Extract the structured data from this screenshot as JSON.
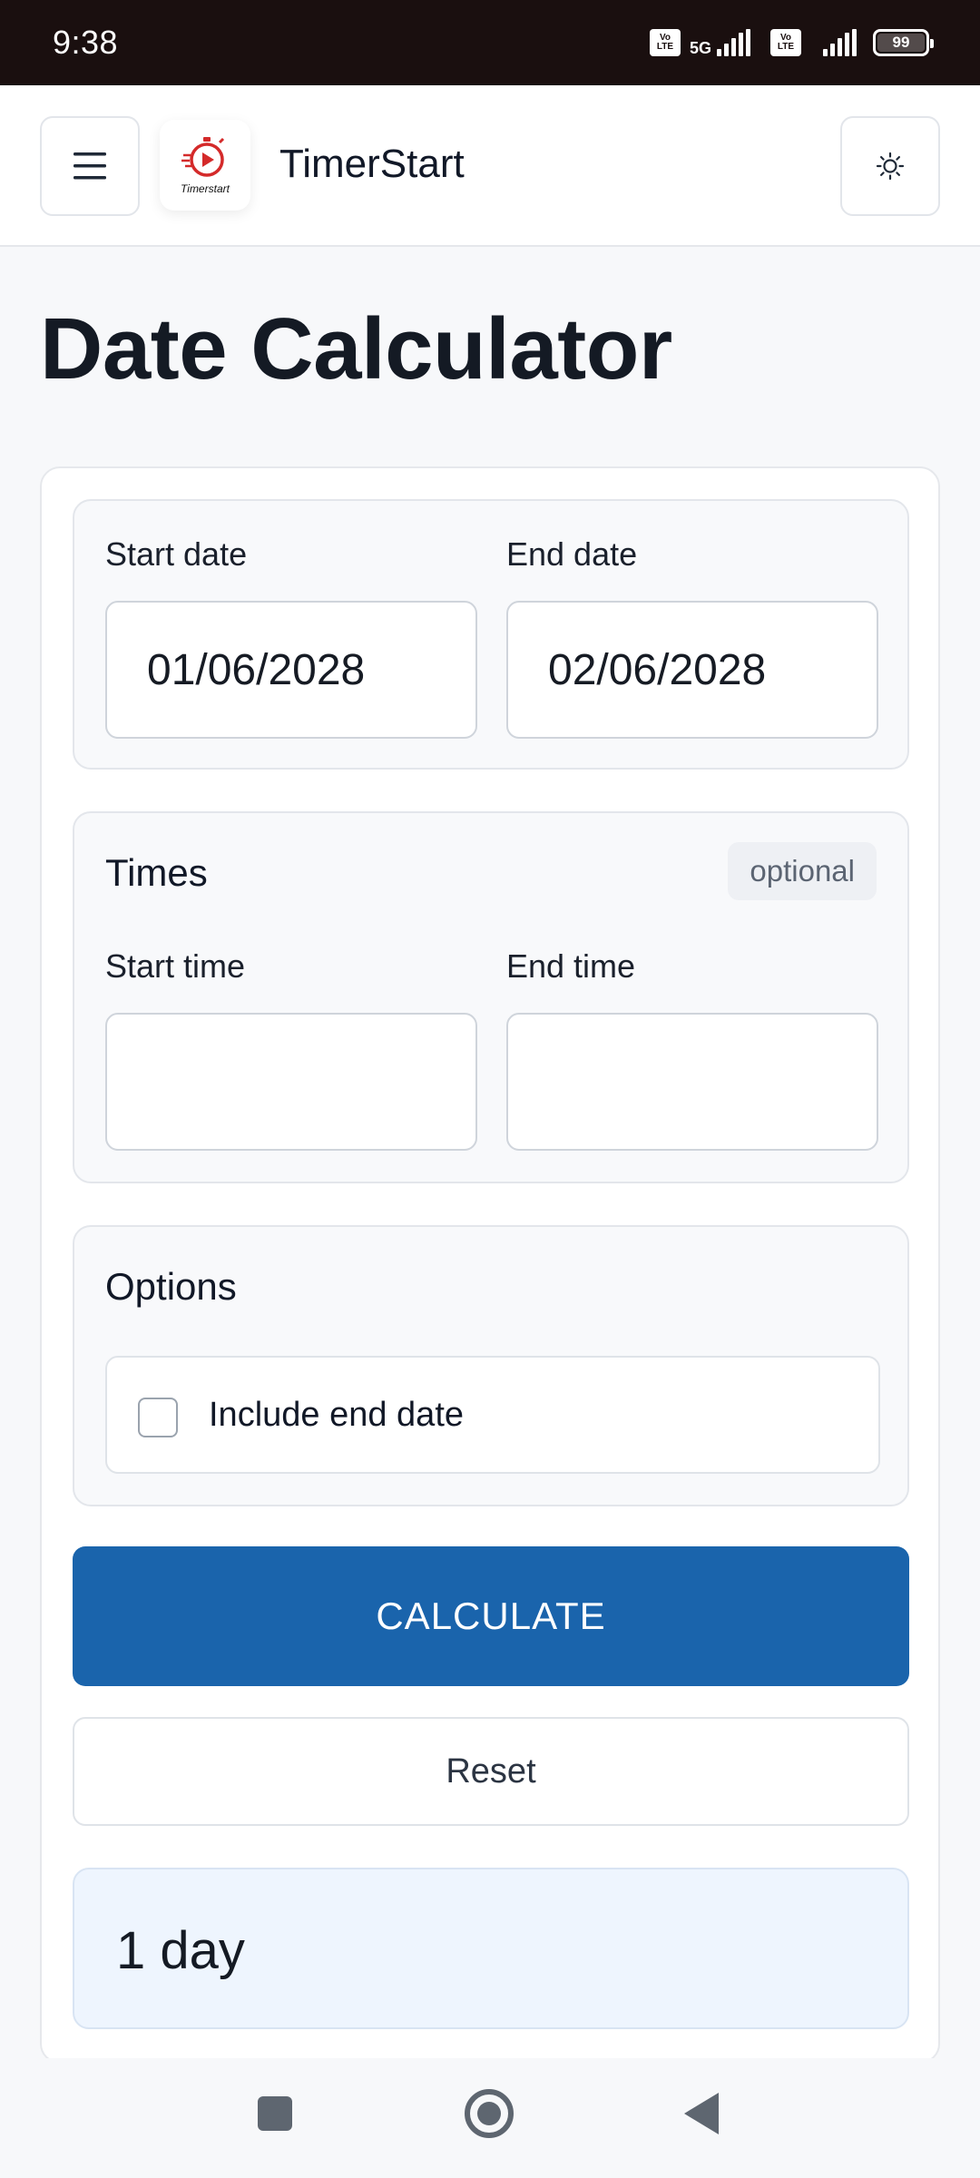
{
  "status_bar": {
    "time": "9:38",
    "network_type": "5G",
    "volte_label": "Vo LTE",
    "battery": "99"
  },
  "header": {
    "brand": "TimerStart",
    "logo_wordmark": "Timerstart",
    "menu_icon": "hamburger-icon",
    "theme_icon": "sun-icon"
  },
  "page": {
    "title": "Date Calculator"
  },
  "dates": {
    "start_label": "Start date",
    "start_value": "01/06/2028",
    "end_label": "End date",
    "end_value": "02/06/2028"
  },
  "times": {
    "title": "Times",
    "badge": "optional",
    "start_label": "Start time",
    "start_value": "",
    "end_label": "End time",
    "end_value": ""
  },
  "options": {
    "title": "Options",
    "include_end_date_label": "Include end date",
    "include_end_date_checked": false
  },
  "actions": {
    "calculate_label": "CALCULATE",
    "reset_label": "Reset"
  },
  "result": {
    "text": "1 day"
  },
  "colors": {
    "primary": "#1a64ac",
    "result_bg": "#eef5fe",
    "status_bar_bg": "#1a0f0f",
    "logo_red": "#d42a2a"
  }
}
